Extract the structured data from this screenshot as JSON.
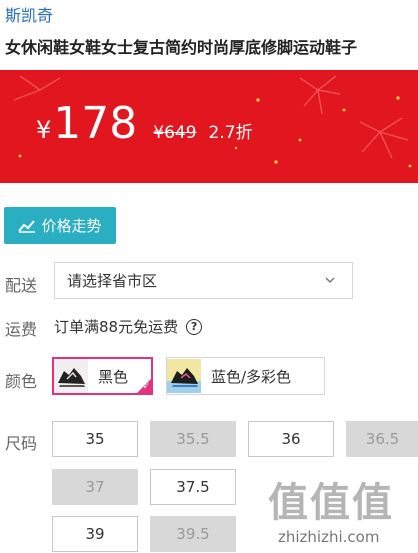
{
  "brand": "斯凯奇",
  "title": "女休闲鞋女鞋女士复古简约时尚厚底修脚运动鞋子",
  "price": {
    "symbol": "¥",
    "current": "178",
    "original": "¥649",
    "discount": "2.7折",
    "banner_color": "#e1161f"
  },
  "trend_button": {
    "label": "价格走势",
    "icon": "chart-line-icon",
    "color": "#29aec2"
  },
  "delivery": {
    "label": "配送",
    "value": "请选择省市区"
  },
  "shipping": {
    "label": "运费",
    "text": "订单满88元免运费",
    "help": "?"
  },
  "colors": {
    "label": "颜色",
    "options": [
      {
        "label": "黑色",
        "selected": true
      },
      {
        "label": "蓝色/多彩色",
        "selected": false
      }
    ]
  },
  "sizes": {
    "label": "尺码",
    "options": [
      {
        "label": "35",
        "available": true
      },
      {
        "label": "35.5",
        "available": false
      },
      {
        "label": "36",
        "available": true
      },
      {
        "label": "36.5",
        "available": false
      },
      {
        "label": "37",
        "available": false
      },
      {
        "label": "37.5",
        "available": true
      },
      {
        "label": "39",
        "available": true
      },
      {
        "label": "39.5",
        "available": false
      }
    ]
  },
  "watermark": {
    "chars": "值值值",
    "url": "zhizhizhi.com"
  }
}
